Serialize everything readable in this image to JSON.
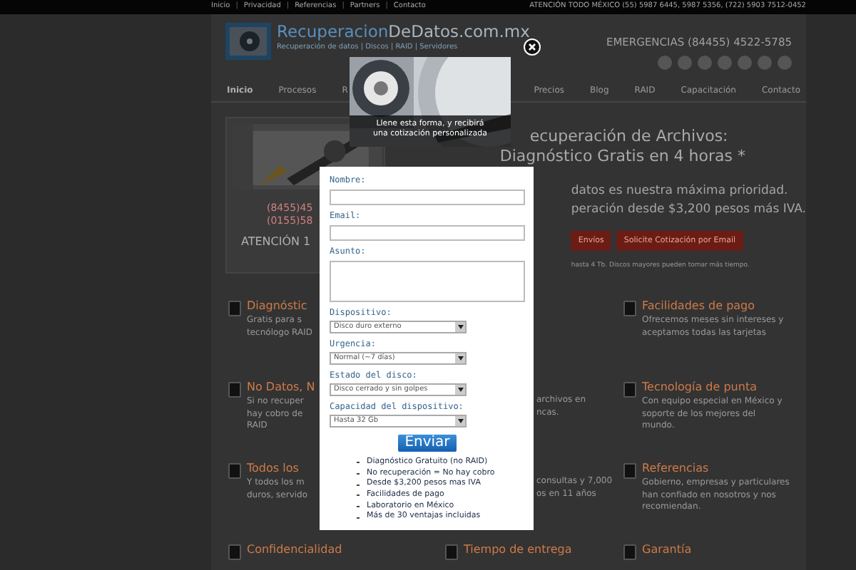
{
  "top_bar": {
    "items": [
      {
        "kind": "link",
        "text": "Inicio"
      },
      {
        "kind": "sep",
        "text": "|"
      },
      {
        "kind": "link",
        "text": "Privacidad"
      },
      {
        "kind": "sep",
        "text": "|"
      },
      {
        "kind": "link",
        "text": "Referencias"
      },
      {
        "kind": "sep",
        "text": "|"
      },
      {
        "kind": "link",
        "text": "Partners"
      },
      {
        "kind": "sep",
        "text": "|"
      },
      {
        "kind": "link",
        "text": "Contacto"
      }
    ],
    "contact": "ATENCIÓN TODO MÉXICO (55) 5987 6445, 5987 5356, (722) 5903 7512-0452"
  },
  "header": {
    "logo_main": "Recuperacion",
    "logo_accent": "DeDatos.com.mx",
    "tagline": "Recuperación de datos | Discos | RAID | Servidores",
    "emergency": "EMERGENCIAS (84455) 4522-5785"
  },
  "nav": [
    {
      "label": "Inicio",
      "selected": true
    },
    {
      "label": "Procesos",
      "selected": false
    },
    {
      "label": "R",
      "selected": false
    },
    {
      "label": "Precios",
      "selected": false
    },
    {
      "label": "Blog",
      "selected": false
    },
    {
      "label": "RAID",
      "selected": false
    },
    {
      "label": "Capacitación",
      "selected": false
    },
    {
      "label": "Contacto",
      "selected": false
    }
  ],
  "hero": {
    "phones": [
      "(8455)45",
      "(0155)58"
    ],
    "attention": "ATENCIÓN 1",
    "heading": [
      "ecuperación de Archivos:",
      "Diagnóstico Gratis en 4 horas *"
    ],
    "lines": [
      "datos es nuestra máxima prioridad.",
      "peración desde $3,200 pesos más IVA."
    ],
    "buttons": [
      "Envíos",
      "Solicite Cotización por Email"
    ],
    "note": "hasta 4 Tb. Discos mayores pueden tomar más tiempo."
  },
  "features": [
    {
      "kind": "full",
      "title": "Diagnóstic",
      "lines": [
        "Gratis para s",
        "tecnólogo RAID"
      ]
    },
    {
      "kind": "peek"
    },
    {
      "kind": "full",
      "title": "Facilidades de pago",
      "lines": [
        "Ofrecemos meses sin intereses y",
        "aceptamos todas las tarjetas"
      ]
    },
    {
      "kind": "full",
      "title": "No Datos, N",
      "lines": [
        "Si no recuper",
        "hay cobro de",
        "RAID"
      ]
    },
    {
      "kind": "peek",
      "lines": [
        "archivos en",
        "ncas."
      ]
    },
    {
      "kind": "full",
      "title": "Tecnología de punta",
      "lines": [
        "Con equipo especial en México y",
        "soporte de los mejores del",
        "mundo."
      ]
    },
    {
      "kind": "full",
      "title": "Todos los",
      "lines": [
        "Y todos los m",
        "duros, servido"
      ]
    },
    {
      "kind": "peek",
      "lines": [
        "consultas y 7,000",
        "os en 11 años"
      ]
    },
    {
      "kind": "full",
      "title": "Referencias",
      "lines": [
        "Gobierno, empresas y particulares",
        "han confiado en nosotros y nos",
        "recomiendan."
      ]
    },
    {
      "kind": "full",
      "title": "Confidencialidad"
    },
    {
      "kind": "full",
      "title": "Tiempo de entrega"
    },
    {
      "kind": "full",
      "title": "Garantía"
    }
  ],
  "modal": {
    "caption": [
      "Llene esta forma, y recibirá",
      "una cotización personalizada"
    ],
    "fields": [
      {
        "kind": "text",
        "label": "Nombre:"
      },
      {
        "kind": "text",
        "label": "Email:"
      },
      {
        "kind": "textarea",
        "label": "Asunto:"
      },
      {
        "kind": "select",
        "label": "Dispositivo:",
        "value": "Disco duro externo"
      },
      {
        "kind": "select",
        "label": "Urgencia:",
        "value": "Normal (~7 días)"
      },
      {
        "kind": "select",
        "label": "Estado del disco:",
        "value": "Disco cerrado y sin golpes"
      },
      {
        "kind": "select",
        "label": "Capacidad del dispositivo:",
        "value": "Hasta 32 Gb"
      }
    ],
    "submit": "Enviar",
    "bullets": [
      "Diagnóstico Gratuito (no RAID)",
      "No recuperación = No hay cobro",
      "Desde $3,200 pesos mas IVA",
      "Facilidades de pago",
      "Laboratorio en México",
      "Más de 30 ventajas incluidas"
    ]
  }
}
